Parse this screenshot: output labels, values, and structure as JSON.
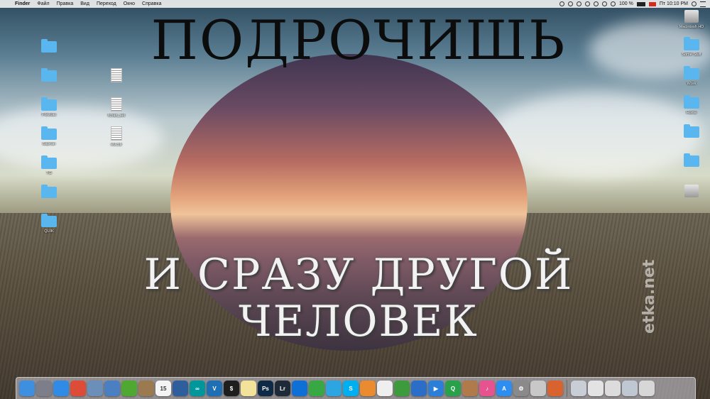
{
  "menubar": {
    "app_name": "Finder",
    "menus": [
      "Файл",
      "Правка",
      "Вид",
      "Переход",
      "Окно",
      "Справка"
    ],
    "battery": "100 %",
    "clock": "Пт 10:10 PM"
  },
  "wallpaper": {
    "top_text": "ПОДРОЧИШЬ",
    "bottom_line1": "И СРАЗУ ДРУГОЙ",
    "bottom_line2": "ЧЕЛОВЕК",
    "watermark": "etka.net"
  },
  "desktop_left": [
    {
      "type": "folder",
      "label": ""
    },
    {
      "type": "folder",
      "label": ""
    },
    {
      "type": "folder",
      "label": "Portfolio"
    },
    {
      "type": "folder",
      "label": "Бартан"
    },
    {
      "type": "folder",
      "label": "TG"
    },
    {
      "type": "folder",
      "label": ""
    },
    {
      "type": "folder",
      "label": "QUIK"
    }
  ],
  "desktop_mid": [
    {
      "type": "doc",
      "label": ""
    },
    {
      "type": "doc",
      "label": "fchart_set"
    },
    {
      "type": "doc",
      "label": "elv.cdr"
    }
  ],
  "desktop_right": [
    {
      "type": "drive",
      "label": "Macintosh HD"
    },
    {
      "type": "folder",
      "label": "Some Stuff"
    },
    {
      "type": "folder",
      "label": "Work"
    },
    {
      "type": "folder",
      "label": "Home"
    },
    {
      "type": "folder",
      "label": ""
    },
    {
      "type": "folder",
      "label": ""
    },
    {
      "type": "drive",
      "label": ""
    }
  ],
  "dock": {
    "apps": [
      {
        "name": "finder-icon",
        "color": "#3e8fe0",
        "glyph": ""
      },
      {
        "name": "launchpad-icon",
        "color": "#7c7f8a",
        "glyph": ""
      },
      {
        "name": "safari-icon",
        "color": "#2f8be6",
        "glyph": ""
      },
      {
        "name": "chrome-icon",
        "color": "#dd4b39",
        "glyph": ""
      },
      {
        "name": "preview-icon",
        "color": "#6b8fb8",
        "glyph": ""
      },
      {
        "name": "photos-icon",
        "color": "#4a7fc1",
        "glyph": ""
      },
      {
        "name": "leaf-app-icon",
        "color": "#4fa832",
        "glyph": ""
      },
      {
        "name": "archive-icon",
        "color": "#9a7a4e",
        "glyph": ""
      },
      {
        "name": "calendar-icon",
        "color": "#f4f4f4",
        "glyph": "15"
      },
      {
        "name": "iphoto-icon",
        "color": "#2e5f9c",
        "glyph": ""
      },
      {
        "name": "arduino-icon",
        "color": "#00979c",
        "glyph": "∞"
      },
      {
        "name": "vscode-icon",
        "color": "#1f6fb5",
        "glyph": "V"
      },
      {
        "name": "terminal-icon",
        "color": "#1e1e1e",
        "glyph": "$"
      },
      {
        "name": "notes-icon",
        "color": "#f3e39a",
        "glyph": ""
      },
      {
        "name": "photoshop-icon",
        "color": "#0e2a46",
        "glyph": "Ps"
      },
      {
        "name": "lightroom-icon",
        "color": "#1e2a38",
        "glyph": "Lr"
      },
      {
        "name": "teamviewer-icon",
        "color": "#0e6fd6",
        "glyph": ""
      },
      {
        "name": "facetime-icon",
        "color": "#38a845",
        "glyph": ""
      },
      {
        "name": "telegram-icon",
        "color": "#2ca5e0",
        "glyph": ""
      },
      {
        "name": "skype-icon",
        "color": "#00aff0",
        "glyph": "S"
      },
      {
        "name": "pinwheel-icon",
        "color": "#e98b2e",
        "glyph": ""
      },
      {
        "name": "textedit-icon",
        "color": "#efefef",
        "glyph": ""
      },
      {
        "name": "numbers-icon",
        "color": "#3d9b3d",
        "glyph": ""
      },
      {
        "name": "keynote-icon",
        "color": "#2b6ec7",
        "glyph": ""
      },
      {
        "name": "quicktime-icon",
        "color": "#2c7fd8",
        "glyph": "▶"
      },
      {
        "name": "q-app-icon",
        "color": "#29a04a",
        "glyph": "Q"
      },
      {
        "name": "contacts-icon",
        "color": "#b07a4a",
        "glyph": ""
      },
      {
        "name": "itunes-icon",
        "color": "#e6538e",
        "glyph": "♪"
      },
      {
        "name": "appstore-icon",
        "color": "#2d8df1",
        "glyph": "A"
      },
      {
        "name": "system-preferences-icon",
        "color": "#8a8a8a",
        "glyph": "⚙"
      },
      {
        "name": "script-icon",
        "color": "#c8c8c8",
        "glyph": ""
      },
      {
        "name": "firefox-icon",
        "color": "#d9632f",
        "glyph": ""
      }
    ],
    "stacks": [
      {
        "name": "stack-screenshots-icon",
        "color": "#c9cdd6",
        "glyph": ""
      },
      {
        "name": "stack-documents-icon",
        "color": "#e3e3e3",
        "glyph": ""
      },
      {
        "name": "stack-downloads-icon",
        "color": "#dcdcdc",
        "glyph": ""
      },
      {
        "name": "stack-images-icon",
        "color": "#bfc7d2",
        "glyph": ""
      },
      {
        "name": "trash-icon",
        "color": "#d7d7d7",
        "glyph": ""
      }
    ]
  }
}
